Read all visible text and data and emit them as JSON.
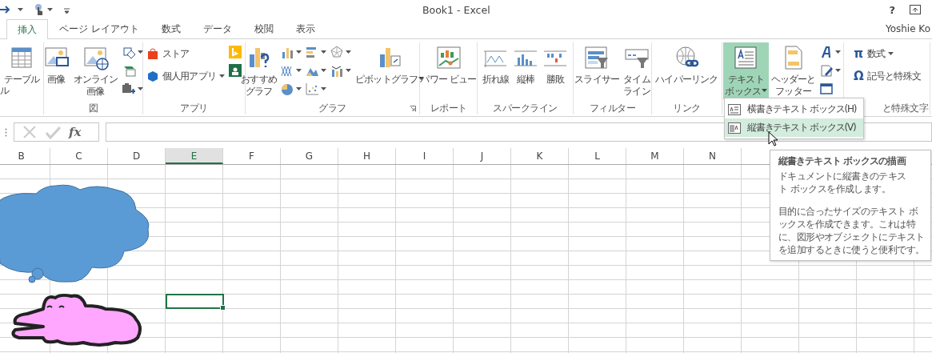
{
  "window": {
    "title": "Book1 - Excel",
    "user": "Yoshie Ko"
  },
  "quick_access": [
    {
      "kind": "redo",
      "dropdown": true
    },
    {
      "kind": "touch",
      "dropdown": true
    },
    {
      "kind": "customize"
    }
  ],
  "title_buttons": [
    "?"
  ],
  "tabs": [
    {
      "label": "挿入",
      "selected": true
    },
    {
      "label": "ページ レイアウト",
      "selected": false
    },
    {
      "label": "数式",
      "selected": false
    },
    {
      "label": "データ",
      "selected": false
    },
    {
      "label": "校閲",
      "selected": false
    },
    {
      "label": "表示",
      "selected": false
    }
  ],
  "ribbon": {
    "groups": [
      {
        "controls": [
          {
            "kind": "large",
            "lines": [
              "テーブル"
            ],
            "dropdown": false,
            "selected": false
          },
          {
            "kind": "clipped",
            "label": "ル"
          }
        ]
      },
      {
        "label": "図",
        "controls": [
          {
            "kind": "large",
            "lines": [
              "画像"
            ],
            "dropdown": false,
            "selected": false
          },
          {
            "kind": "large",
            "lines": [
              "オンライン",
              "画像"
            ],
            "dropdown": false,
            "selected": false
          },
          {
            "kind": "stack",
            "items": [
              {
                "kind": "icon",
                "dropdown": true
              },
              {
                "kind": "icon",
                "dropdown": false
              },
              {
                "kind": "icon",
                "dropdown": true
              }
            ]
          }
        ]
      },
      {
        "label": "アプリ",
        "controls": [
          {
            "kind": "stack",
            "items": [
              {
                "kind": "small",
                "label": "ストア",
                "dropdown": false
              },
              {
                "kind": "small",
                "label": "個人用アプリ",
                "dropdown": true
              }
            ]
          },
          {
            "kind": "stack",
            "items": [
              {
                "kind": "icon",
                "dropdown": false
              },
              {
                "kind": "icon",
                "dropdown": false
              }
            ]
          }
        ]
      },
      {
        "label": "グラフ",
        "launcher": true,
        "controls": [
          {
            "kind": "large",
            "lines": [
              "おすすめ",
              "グラフ"
            ],
            "dropdown": false,
            "selected": false
          },
          {
            "kind": "stack",
            "items": [
              {
                "kind": "icon",
                "dropdown": true
              },
              {
                "kind": "icon",
                "dropdown": true
              },
              {
                "kind": "icon",
                "dropdown": true
              }
            ]
          },
          {
            "kind": "stack",
            "items": [
              {
                "kind": "icon",
                "dropdown": true
              },
              {
                "kind": "icon",
                "dropdown": true
              },
              {
                "kind": "icon",
                "dropdown": true
              }
            ]
          },
          {
            "kind": "stack",
            "items": [
              {
                "kind": "icon",
                "dropdown": true
              },
              {
                "kind": "icon",
                "dropdown": true
              }
            ]
          },
          {
            "kind": "large",
            "lines": [
              "ピボットグラフ"
            ],
            "dropdown": true,
            "selected": false
          }
        ]
      },
      {
        "label": "レポート",
        "controls": [
          {
            "kind": "large",
            "lines": [
              "パワー ビュー"
            ],
            "dropdown": false,
            "selected": false
          }
        ]
      },
      {
        "label": "スパークライン",
        "controls": [
          {
            "kind": "large",
            "lines": [
              "折れ線"
            ],
            "dropdown": false,
            "selected": false
          },
          {
            "kind": "large",
            "lines": [
              "縦棒"
            ],
            "dropdown": false,
            "selected": false
          },
          {
            "kind": "large",
            "lines": [
              "勝敗"
            ],
            "dropdown": false,
            "selected": false
          }
        ]
      },
      {
        "label": "フィルター",
        "controls": [
          {
            "kind": "large",
            "lines": [
              "スライサー"
            ],
            "dropdown": false,
            "selected": false
          },
          {
            "kind": "large",
            "lines": [
              "タイム",
              "ライン"
            ],
            "dropdown": false,
            "selected": false
          }
        ]
      },
      {
        "label": "リンク",
        "controls": [
          {
            "kind": "large",
            "lines": [
              "ハイパーリンク"
            ],
            "dropdown": false,
            "selected": false
          }
        ]
      },
      {
        "controls": [
          {
            "kind": "large",
            "lines": [
              "テキスト",
              "ボックス"
            ],
            "dropdown": true,
            "selected": true
          },
          {
            "kind": "large",
            "lines": [
              "ヘッダーと",
              "フッター"
            ],
            "dropdown": false,
            "selected": false
          },
          {
            "kind": "stack",
            "items": [
              {
                "kind": "icon",
                "dropdown": true
              },
              {
                "kind": "icon",
                "dropdown": true
              },
              {
                "kind": "icon",
                "dropdown": false
              }
            ]
          }
        ]
      },
      {
        "label": "と特殊文字",
        "controls": [
          {
            "kind": "stack",
            "items": [
              {
                "kind": "small",
                "glyph": "π",
                "label": "数式",
                "dropdown": true
              },
              {
                "kind": "small",
                "glyph": "Ω",
                "label": "記号と特殊文",
                "dropdown": false
              }
            ]
          }
        ]
      }
    ]
  },
  "formula_bar": {
    "function_label": "fx"
  },
  "columns": [
    {
      "label": "B",
      "selected": false
    },
    {
      "label": "C",
      "selected": false
    },
    {
      "label": "D",
      "selected": false
    },
    {
      "label": "E",
      "selected": true
    },
    {
      "label": "F",
      "selected": false
    },
    {
      "label": "G",
      "selected": false
    },
    {
      "label": "H",
      "selected": false
    },
    {
      "label": "I",
      "selected": false
    },
    {
      "label": "J",
      "selected": false
    },
    {
      "label": "K",
      "selected": false
    },
    {
      "label": "L",
      "selected": false
    },
    {
      "label": "M",
      "selected": false
    },
    {
      "label": "N",
      "selected": false
    }
  ],
  "dropdown_menu": [
    {
      "label": "横書きテキスト ボックス(H)",
      "selected": false
    },
    {
      "label": "縦書きテキスト ボックス(V)",
      "selected": true
    }
  ],
  "tooltip": {
    "title": "縦書きテキスト ボックスの描画",
    "paragraphs": [
      "ドキュメントに縦書きのテキスト ボックスを作成します。",
      "目的に合ったサイズのテキスト ボックスを作成できます。これは特に、図形やオブジェクトにテキストを追加するときに使うと便利です。"
    ]
  }
}
